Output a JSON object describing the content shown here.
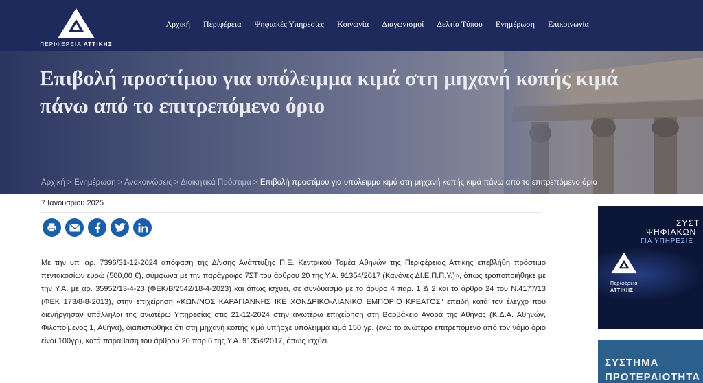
{
  "header": {
    "logo_text_normal": "ΠΕΡΙΦΕΡΕΙΑ",
    "logo_text_bold": "ΑΤΤΙΚΗΣ",
    "nav": [
      "Αρχική",
      "Περιφέρεια",
      "Ψηφιακές Υπηρεσίες",
      "Κοινωνία",
      "Διαγωνισμοί",
      "Δελτία Τύπου",
      "Ενημέρωση",
      "Επικοινωνία"
    ]
  },
  "hero": {
    "title": "Επιβολή προστίμου για υπόλειμμα κιμά στη μηχανή κοπής κιμά πάνω από το επιτρεπόμενο όριο",
    "breadcrumb": [
      "Αρχική",
      "Ενημέρωση",
      "Ανακοινώσεις",
      "Διοικητικά Πρόστιμα"
    ],
    "breadcrumb_current": "Επιβολή προστίμου για υπόλειμμα κιμά στη μηχανή κοπής κιμά πάνω από το επιτρεπόμενο όριο",
    "breadcrumb_sep": ">"
  },
  "article": {
    "date": "7 Ιανουαρίου 2025",
    "share_icons": [
      "print-icon",
      "email-icon",
      "facebook-icon",
      "twitter-icon",
      "linkedin-icon"
    ],
    "body": "Με την υπ' αρ. 7396/31-12-2024  απόφαση της Δ/νσης Ανάπτυξης Π.Ε. Κεντρικού Τομέα Αθηνών της Περιφέρειας Αττικής επεβλήθη πρόστιμο πεντακοσίων  ευρώ  (500,00  €), σύμφωνα με την παράγραφο 7ΣΤ του άρθρου 20 της Υ.Α. 91354/2017 (Κανόνες ΔΙ.Ε.Π.Π.Υ.)», όπως τροποποιήθηκε με την Υ.Α. με αρ. 35952/13-4-23 (ΦΕΚ/Β/2542/18-4-2023) και όπως ισχύει,  σε συνδυασμό  με  το  άρθρο  4  παρ. 1 & 2  και το άρθρο 24 του Ν.4177/13 (ΦΕΚ 173/8-8-2013), στην επιχείρηση «ΚΩΝ/ΝΟΣ ΚΑΡΑΓΙΑΝΝΗΣ ΙΚΕ ΧΟΝΔΡΙΚΟ-ΛΙΑΝΙΚΟ ΕΜΠΟΡΙΟ ΚΡΕΑΤΟΣ\" επειδή κατά τον έλεγχο που διενήργησαν υπάλληλοι της ανωτέρω Υπηρεσίας στις 21-12-2024 στην ανωτέρω επιχείρηση στη Βαρβάκειο Αγορά της Αθήνας (Κ.Δ.Α. Αθηνών, Φιλοποίμενος 1, Αθήνα), διαπιστώθηκε ότι στη μηχανή κοπής κιμά υπήρχε υπόλειμμα κιμά 150 γρ. (ενώ το ανώτερο επιτρεπόμενο από τον νόμο όριο είναι 100γρ), κατά παράβαση του άρθρου 20 παρ.6 της Υ.Α. 91354/2017, όπως ισχύει."
  },
  "sidebar": {
    "banner1": {
      "line1": "ΣΥΣΤ",
      "line2": "ΨΗΦΙΑΚΩΝ",
      "line3": "ΓΙΑ ΥΠΗΡΕΣΙΕ",
      "logo_t1": "Περιφέρεια",
      "logo_t2": "ΑΤΤΙΚΗΣ"
    },
    "banner2": {
      "line1": "ΣΥΣΤΗΜΑ",
      "line2": "ΠΡΟΤΕΡΑΙΟΤΗΤΑ"
    }
  },
  "colors": {
    "header_bg": "#1f2a5c",
    "share_blue": "#1c5fa8"
  }
}
